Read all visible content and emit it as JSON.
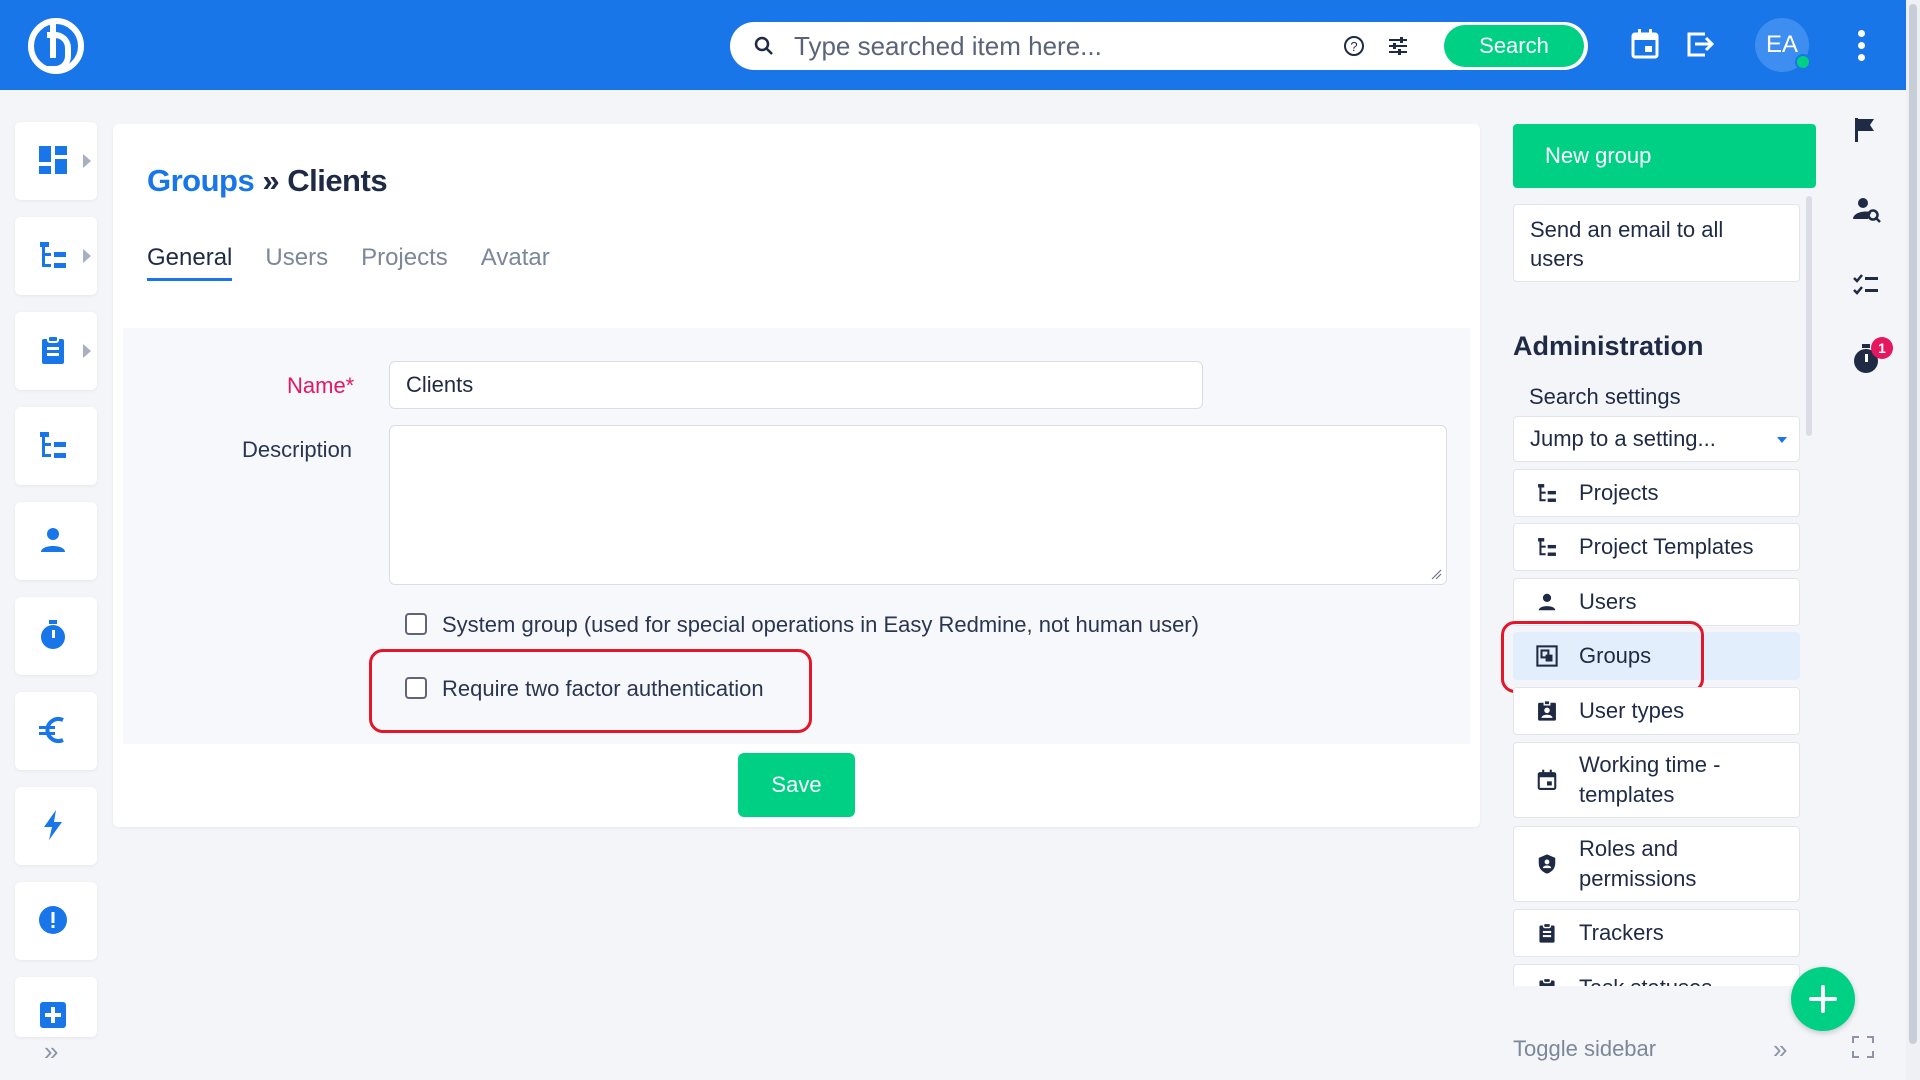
{
  "topbar": {
    "search_placeholder": "Type searched item here...",
    "search_button": "Search",
    "user_initials": "EA"
  },
  "page": {
    "breadcrumb_parent": "Groups",
    "breadcrumb_separator": " » ",
    "title": "Clients",
    "tabs": [
      {
        "label": "General",
        "active": true
      },
      {
        "label": "Users",
        "active": false
      },
      {
        "label": "Projects",
        "active": false
      },
      {
        "label": "Avatar",
        "active": false
      }
    ]
  },
  "form": {
    "name_label": "Name*",
    "name_value": "Clients",
    "description_label": "Description",
    "description_value": "",
    "system_group_label": "System group",
    "system_group_hint": "(used for special operations in Easy Redmine, not human user)",
    "system_group_checked": false,
    "two_factor_label": "Require two factor authentication",
    "two_factor_checked": false,
    "save_button": "Save"
  },
  "sidebar": {
    "new_group": "New group",
    "send_email": "Send an email to all users",
    "admin_heading": "Administration",
    "search_settings": "Search settings",
    "jump_placeholder": "Jump to a setting...",
    "items": [
      {
        "label": "Projects",
        "icon": "project-tree-icon",
        "active": false
      },
      {
        "label": "Project Templates",
        "icon": "project-tree-icon",
        "active": false
      },
      {
        "label": "Users",
        "icon": "user-icon",
        "active": false
      },
      {
        "label": "Groups",
        "icon": "groups-icon",
        "active": true
      },
      {
        "label": "User types",
        "icon": "id-badge-icon",
        "active": false
      },
      {
        "label": "Working time - templates",
        "icon": "calendar-icon",
        "active": false
      },
      {
        "label": "Roles and permissions",
        "icon": "shield-icon",
        "active": false
      },
      {
        "label": "Trackers",
        "icon": "clipboard-icon",
        "active": false
      },
      {
        "label": "Task statuses",
        "icon": "clipboard-icon",
        "active": false
      }
    ],
    "toggle": "Toggle sidebar"
  },
  "notifications": {
    "timer_badge": "1"
  },
  "colors": {
    "primary": "#1976e8",
    "success": "#00d084",
    "required": "#e5175e",
    "highlight": "#e3162a"
  }
}
